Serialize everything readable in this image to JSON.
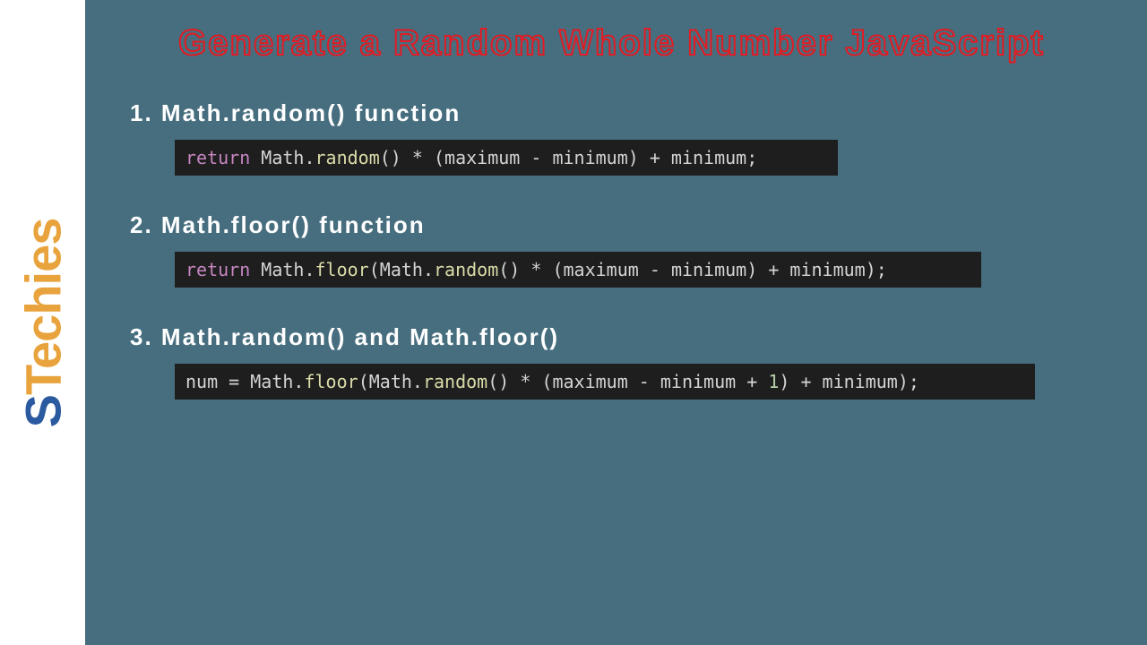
{
  "logo": "STechies",
  "title": "Generate a Random Whole Number JavaScript",
  "sections": [
    {
      "heading": "1. Math.random() function",
      "code_tokens": {
        "return": "return",
        "math1": "Math",
        "dot1": ".",
        "random": "random",
        "paren1": "()",
        "mul": " * ",
        "paren2": "(",
        "max": "maximum",
        "minus": " - ",
        "min": "minimum",
        "paren3": ")",
        "plus": " + ",
        "min2": "minimum",
        "semi": ";"
      }
    },
    {
      "heading": "2. Math.floor() function",
      "code_tokens": {
        "return": "return",
        "math1": "Math",
        "dot1": ".",
        "floor": "floor",
        "paren1": "(",
        "math2": "Math",
        "dot2": ".",
        "random": "random",
        "paren2": "()",
        "mul": " * ",
        "paren3": "(",
        "max": "maximum",
        "minus": " - ",
        "min": "minimum",
        "paren4": ")",
        "plus": " + ",
        "min2": "minimum",
        "paren5": ")",
        "semi": ";"
      }
    },
    {
      "heading": "3. Math.random() and Math.floor()",
      "code_tokens": {
        "num": "num",
        "eq": " = ",
        "math1": "Math",
        "dot1": ".",
        "floor": "floor",
        "paren1": "(",
        "math2": "Math",
        "dot2": ".",
        "random": "random",
        "paren2": "()",
        "mul": " * ",
        "paren3": "(",
        "max": "maximum",
        "minus": " - ",
        "min": "minimum",
        "plus1": " + ",
        "one": "1",
        "paren4": ")",
        "plus2": " + ",
        "min2": "minimum",
        "paren5": ")",
        "semi": ";"
      }
    }
  ]
}
